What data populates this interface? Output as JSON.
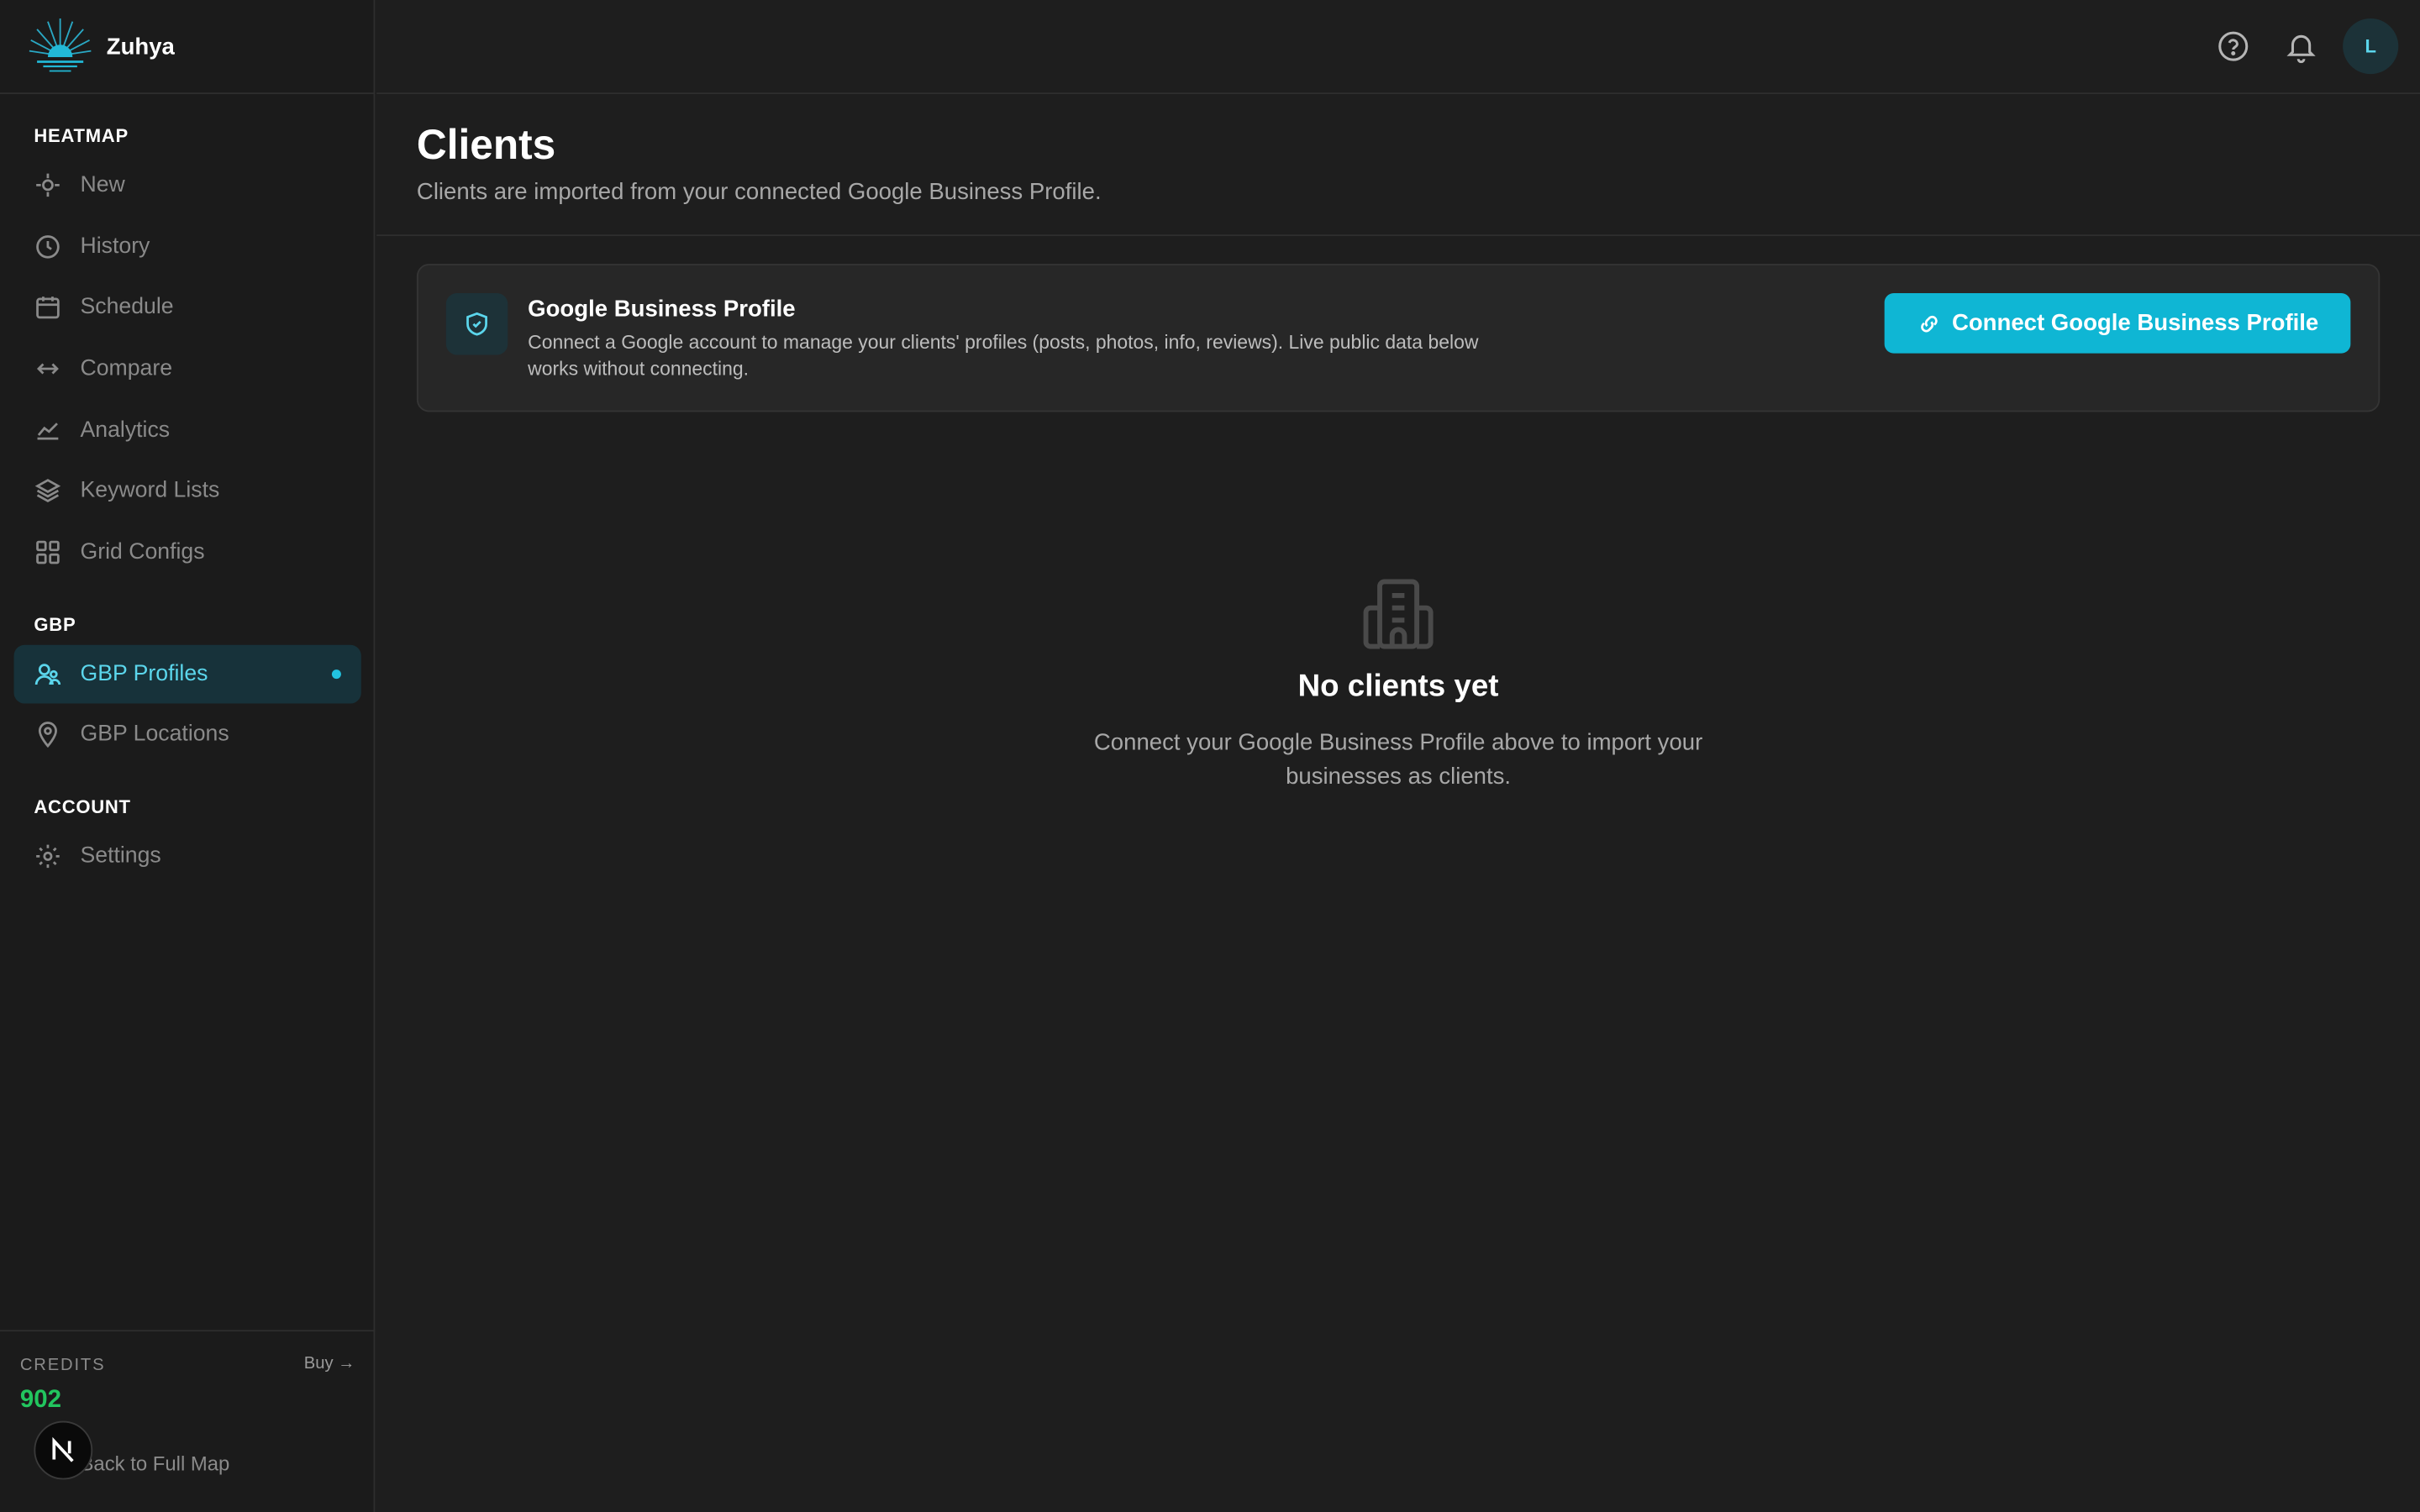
{
  "brand": {
    "name": "Zuhya"
  },
  "sidebar": {
    "sections": [
      {
        "label": "HEATMAP"
      },
      {
        "label": "GBP"
      },
      {
        "label": "ACCOUNT"
      }
    ],
    "items": [
      {
        "label": "New",
        "icon": "crosshair-icon"
      },
      {
        "label": "History",
        "icon": "clock-icon"
      },
      {
        "label": "Schedule",
        "icon": "calendar-icon"
      },
      {
        "label": "Compare",
        "icon": "arrows-horizontal-icon"
      },
      {
        "label": "Analytics",
        "icon": "line-chart-icon"
      },
      {
        "label": "Keyword Lists",
        "icon": "layers-icon"
      },
      {
        "label": "Grid Configs",
        "icon": "grid-icon"
      },
      {
        "label": "GBP Profiles",
        "icon": "users-icon",
        "active": true
      },
      {
        "label": "GBP Locations",
        "icon": "map-pin-icon"
      },
      {
        "label": "Settings",
        "icon": "gear-icon"
      }
    ],
    "credits": {
      "label": "CREDITS",
      "buy_label": "Buy →",
      "value": "902",
      "back_label": "Back to Full Map"
    }
  },
  "topbar": {
    "avatar_initial": "L"
  },
  "page": {
    "title": "Clients",
    "subtitle": "Clients are imported from your connected Google Business Profile."
  },
  "gbp_card": {
    "title": "Google Business Profile",
    "description": "Connect a Google account to manage your clients' profiles (posts, photos, info, reviews). Live public data below works without connecting.",
    "button_label": "Connect Google Business Profile"
  },
  "empty_state": {
    "title": "No clients yet",
    "message": "Connect your Google Business Profile above to import your businesses as clients."
  },
  "colors": {
    "accent": "#0fb6d4",
    "credits": "#22c55e",
    "active_bg": "#17323a"
  }
}
